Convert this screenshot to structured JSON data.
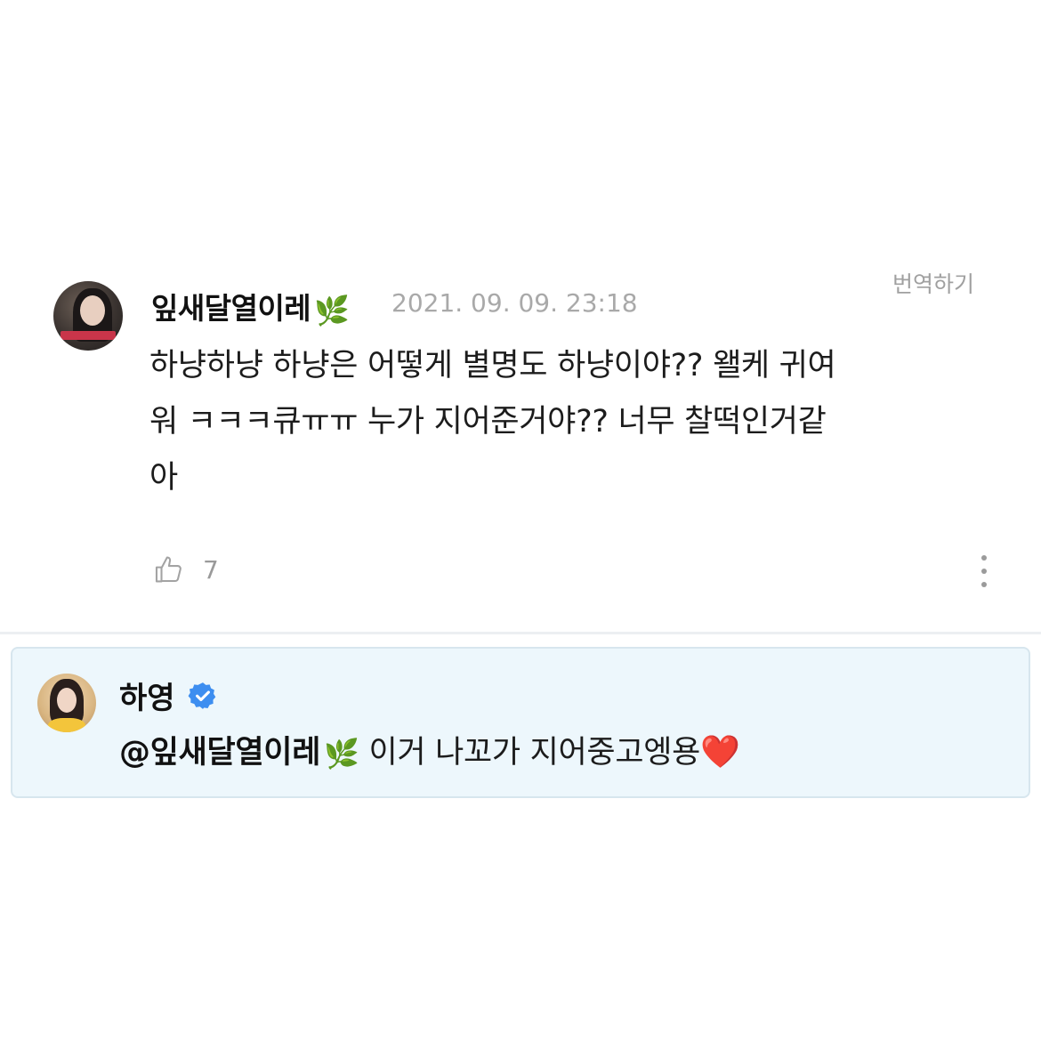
{
  "comment": {
    "username": "잎새달열이레",
    "username_emoji": "🌿",
    "timestamp": "2021. 09. 09. 23:18",
    "translate_label": "번역하기",
    "body": "하냥하냥 하냥은 어떻게 별명도 하냥이야?? 왤케 귀여워 ㅋㅋㅋ큐ㅠㅠ 누가 지어준거야?? 너무 찰떡인거같아",
    "like_count": "7",
    "icons": {
      "like": "thumbs-up-icon",
      "more": "more-vertical-icon"
    }
  },
  "reply": {
    "username": "하영",
    "verified": true,
    "mention": "@잎새달열이레",
    "mention_emoji": "🌿",
    "text": "이거 나꼬가 지어중고엥용",
    "text_emoji": "❤️",
    "icons": {
      "verified": "verified-badge-icon"
    }
  },
  "colors": {
    "reply_background": "#edf7fc",
    "reply_border": "#d7e6ee",
    "verified_badge": "#3d8ef0",
    "muted_text": "#a9a9a9"
  }
}
